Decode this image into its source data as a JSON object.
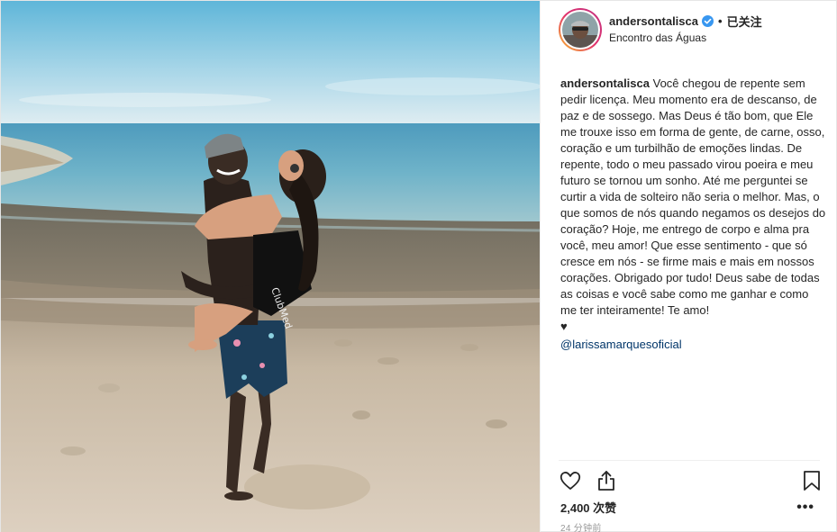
{
  "header": {
    "username": "andersontalisca",
    "separator": "•",
    "follow_status": "已关注",
    "location": "Encontro das Águas"
  },
  "caption": {
    "username": "andersontalisca",
    "text": "Você chegou de repente sem pedir licença. Meu momento era de descanso, de paz e de sossego. Mas Deus é tão bom, que Ele me trouxe isso em forma de gente, de carne, osso, coração e um turbilhão de emoções lindas. De repente, todo o meu passado virou poeira e meu futuro se tornou um sonho. Até me perguntei se curtir a vida de solteiro não seria o melhor. Mas, o que somos de nós quando negamos os desejos do coração? Hoje, me entrego de corpo e alma pra você, meu amor! Que esse sentimento - que só cresce em nós - se firme mais e mais em nossos corações. Obrigado por tudo! Deus sabe de todas as coisas e você sabe como me ganhar e como me ter inteiramente! Te amo!",
    "heart": "♥",
    "mention": "@larissamarquesoficial"
  },
  "actions": {
    "likes": "2,400 次赞",
    "more": "•••",
    "time": "24 分钟前"
  },
  "photo": {
    "shirt_text": "ClubMed"
  },
  "icons": {
    "verified": "verified-badge-icon",
    "like": "heart-outline-icon",
    "share": "share-upload-icon",
    "save": "bookmark-icon",
    "more": "more-options-icon"
  },
  "colors": {
    "verified_blue": "#3897f0",
    "link": "#003569",
    "text": "#262626",
    "muted": "#999999"
  }
}
